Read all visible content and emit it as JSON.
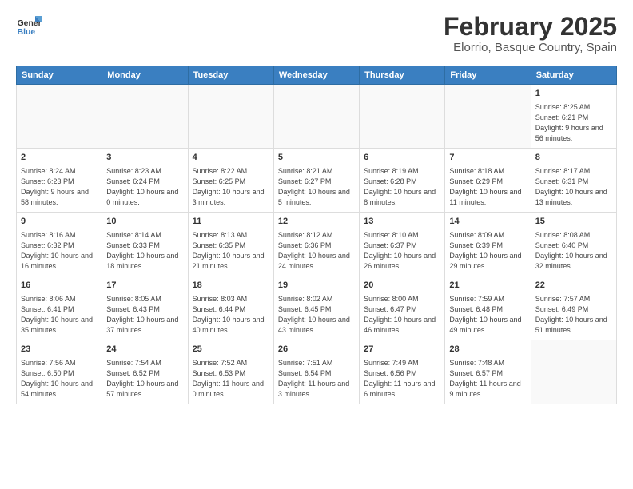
{
  "app": {
    "logo_line1": "General",
    "logo_line2": "Blue"
  },
  "calendar": {
    "title": "February 2025",
    "subtitle": "Elorrio, Basque Country, Spain",
    "days_of_week": [
      "Sunday",
      "Monday",
      "Tuesday",
      "Wednesday",
      "Thursday",
      "Friday",
      "Saturday"
    ],
    "weeks": [
      [
        {
          "day": "",
          "info": ""
        },
        {
          "day": "",
          "info": ""
        },
        {
          "day": "",
          "info": ""
        },
        {
          "day": "",
          "info": ""
        },
        {
          "day": "",
          "info": ""
        },
        {
          "day": "",
          "info": ""
        },
        {
          "day": "1",
          "info": "Sunrise: 8:25 AM\nSunset: 6:21 PM\nDaylight: 9 hours and 56 minutes."
        }
      ],
      [
        {
          "day": "2",
          "info": "Sunrise: 8:24 AM\nSunset: 6:23 PM\nDaylight: 9 hours and 58 minutes."
        },
        {
          "day": "3",
          "info": "Sunrise: 8:23 AM\nSunset: 6:24 PM\nDaylight: 10 hours and 0 minutes."
        },
        {
          "day": "4",
          "info": "Sunrise: 8:22 AM\nSunset: 6:25 PM\nDaylight: 10 hours and 3 minutes."
        },
        {
          "day": "5",
          "info": "Sunrise: 8:21 AM\nSunset: 6:27 PM\nDaylight: 10 hours and 5 minutes."
        },
        {
          "day": "6",
          "info": "Sunrise: 8:19 AM\nSunset: 6:28 PM\nDaylight: 10 hours and 8 minutes."
        },
        {
          "day": "7",
          "info": "Sunrise: 8:18 AM\nSunset: 6:29 PM\nDaylight: 10 hours and 11 minutes."
        },
        {
          "day": "8",
          "info": "Sunrise: 8:17 AM\nSunset: 6:31 PM\nDaylight: 10 hours and 13 minutes."
        }
      ],
      [
        {
          "day": "9",
          "info": "Sunrise: 8:16 AM\nSunset: 6:32 PM\nDaylight: 10 hours and 16 minutes."
        },
        {
          "day": "10",
          "info": "Sunrise: 8:14 AM\nSunset: 6:33 PM\nDaylight: 10 hours and 18 minutes."
        },
        {
          "day": "11",
          "info": "Sunrise: 8:13 AM\nSunset: 6:35 PM\nDaylight: 10 hours and 21 minutes."
        },
        {
          "day": "12",
          "info": "Sunrise: 8:12 AM\nSunset: 6:36 PM\nDaylight: 10 hours and 24 minutes."
        },
        {
          "day": "13",
          "info": "Sunrise: 8:10 AM\nSunset: 6:37 PM\nDaylight: 10 hours and 26 minutes."
        },
        {
          "day": "14",
          "info": "Sunrise: 8:09 AM\nSunset: 6:39 PM\nDaylight: 10 hours and 29 minutes."
        },
        {
          "day": "15",
          "info": "Sunrise: 8:08 AM\nSunset: 6:40 PM\nDaylight: 10 hours and 32 minutes."
        }
      ],
      [
        {
          "day": "16",
          "info": "Sunrise: 8:06 AM\nSunset: 6:41 PM\nDaylight: 10 hours and 35 minutes."
        },
        {
          "day": "17",
          "info": "Sunrise: 8:05 AM\nSunset: 6:43 PM\nDaylight: 10 hours and 37 minutes."
        },
        {
          "day": "18",
          "info": "Sunrise: 8:03 AM\nSunset: 6:44 PM\nDaylight: 10 hours and 40 minutes."
        },
        {
          "day": "19",
          "info": "Sunrise: 8:02 AM\nSunset: 6:45 PM\nDaylight: 10 hours and 43 minutes."
        },
        {
          "day": "20",
          "info": "Sunrise: 8:00 AM\nSunset: 6:47 PM\nDaylight: 10 hours and 46 minutes."
        },
        {
          "day": "21",
          "info": "Sunrise: 7:59 AM\nSunset: 6:48 PM\nDaylight: 10 hours and 49 minutes."
        },
        {
          "day": "22",
          "info": "Sunrise: 7:57 AM\nSunset: 6:49 PM\nDaylight: 10 hours and 51 minutes."
        }
      ],
      [
        {
          "day": "23",
          "info": "Sunrise: 7:56 AM\nSunset: 6:50 PM\nDaylight: 10 hours and 54 minutes."
        },
        {
          "day": "24",
          "info": "Sunrise: 7:54 AM\nSunset: 6:52 PM\nDaylight: 10 hours and 57 minutes."
        },
        {
          "day": "25",
          "info": "Sunrise: 7:52 AM\nSunset: 6:53 PM\nDaylight: 11 hours and 0 minutes."
        },
        {
          "day": "26",
          "info": "Sunrise: 7:51 AM\nSunset: 6:54 PM\nDaylight: 11 hours and 3 minutes."
        },
        {
          "day": "27",
          "info": "Sunrise: 7:49 AM\nSunset: 6:56 PM\nDaylight: 11 hours and 6 minutes."
        },
        {
          "day": "28",
          "info": "Sunrise: 7:48 AM\nSunset: 6:57 PM\nDaylight: 11 hours and 9 minutes."
        },
        {
          "day": "",
          "info": ""
        }
      ]
    ]
  }
}
